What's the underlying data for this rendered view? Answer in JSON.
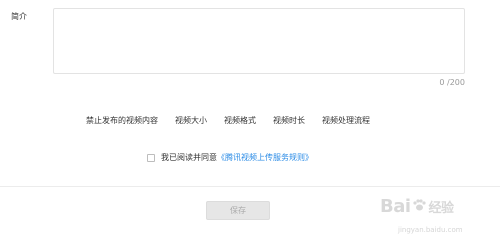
{
  "form": {
    "intro_label": "简介",
    "intro_value": "",
    "char_count": "0 /200"
  },
  "rules": {
    "links": [
      "禁止发布的视频内容",
      "视频大小",
      "视频格式",
      "视频时长",
      "视频处理流程"
    ]
  },
  "agreement": {
    "checked": false,
    "text": "我已阅读并同意",
    "link_text": "《腾讯视频上传服务规则》"
  },
  "actions": {
    "save_label": "保存"
  },
  "watermark": {
    "brand": "Baidu经验",
    "url": "jingyan.baidu.com"
  },
  "colors": {
    "link": "#2a8be6",
    "disabled_button": "#e6e6e6"
  }
}
